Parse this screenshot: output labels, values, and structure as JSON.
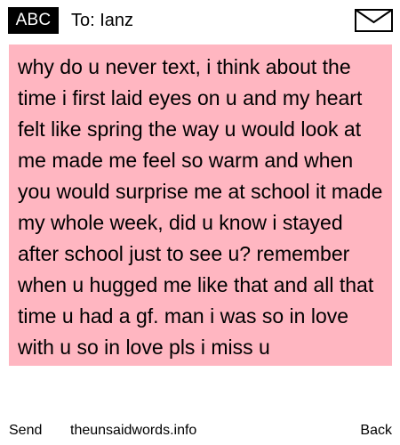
{
  "header": {
    "mode": "ABC",
    "recipient": "To: Ianz"
  },
  "message": {
    "text": "why do u never text, i think about the time i first laid eyes on u and my heart felt like spring the way u would look at me made me feel so warm and when you would surprise me at school it made my whole week, did u know i stayed after school just to see u? remember when u hugged me like that and all that time u had a gf. man i was so in love with u so in love pls i miss u"
  },
  "softkeys": {
    "left": "Send",
    "center": "theunsaidwords.info",
    "right": "Back"
  },
  "colors": {
    "highlight": "#ffb6c1",
    "badge": "#000000"
  },
  "icons": {
    "envelope": "envelope-icon"
  }
}
